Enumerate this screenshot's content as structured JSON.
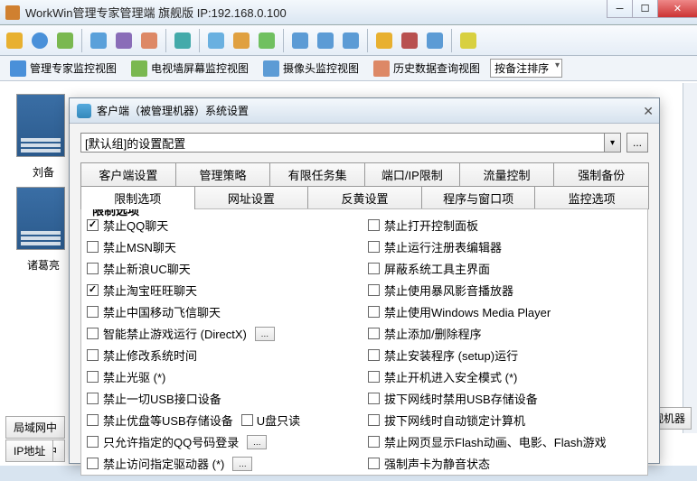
{
  "outer": {
    "title": "WorkWin管理专家管理端  旗舰版 IP:192.168.0.100"
  },
  "viewbar": {
    "v1": "管理专家监控视图",
    "v2": "电视墙屏幕监控视图",
    "v3": "摄像头监控视图",
    "v4": "历史数据查询视图",
    "sort": "按备注排序"
  },
  "thumbs": {
    "t1": "刘备",
    "t2": "诸葛亮"
  },
  "bottom": {
    "b1": "局域网中",
    "b2": "IP地址",
    "r": "监视机器"
  },
  "dialog": {
    "title": "客户端（被管理机器）系统设置",
    "combo": "[默认组]的设置配置",
    "dots": "...",
    "tabs_r1": {
      "t0": "客户端设置",
      "t1": "管理策略",
      "t2": "有限任务集",
      "t3": "端口/IP限制",
      "t4": "流量控制",
      "t5": "强制备份"
    },
    "tabs_r2": {
      "t0": "限制选项",
      "t1": "网址设置",
      "t2": "反黄设置",
      "t3": "程序与窗口项",
      "t4": "监控选项"
    },
    "group_title": "限制选项",
    "left": {
      "c0": {
        "label": "禁止QQ聊天",
        "checked": true
      },
      "c1": {
        "label": "禁止MSN聊天",
        "checked": false
      },
      "c2": {
        "label": "禁止新浪UC聊天",
        "checked": false
      },
      "c3": {
        "label": "禁止淘宝旺旺聊天",
        "checked": true
      },
      "c4": {
        "label": "禁止中国移动飞信聊天",
        "checked": false
      },
      "c5": {
        "label": "智能禁止游戏运行 (DirectX)",
        "checked": false,
        "btn": true
      },
      "c6": {
        "label": "禁止修改系统时间",
        "checked": false
      },
      "c7": {
        "label": "禁止光驱 (*)",
        "checked": false
      },
      "c8": {
        "label": "禁止一切USB接口设备",
        "checked": false
      },
      "c9": {
        "label": "禁止优盘等USB存储设备",
        "checked": false,
        "inline_label": "U盘只读"
      },
      "c10": {
        "label": "只允许指定的QQ号码登录",
        "checked": false,
        "btn": true
      },
      "c11": {
        "label": "禁止访问指定驱动器 (*)",
        "checked": false,
        "btn": true
      }
    },
    "right": {
      "c0": {
        "label": "禁止打开控制面板",
        "checked": false
      },
      "c1": {
        "label": "禁止运行注册表编辑器",
        "checked": false
      },
      "c2": {
        "label": "屏蔽系统工具主界面",
        "checked": false
      },
      "c3": {
        "label": "禁止使用暴风影音播放器",
        "checked": false
      },
      "c4": {
        "label": "禁止使用Windows Media Player",
        "checked": false
      },
      "c5": {
        "label": "禁止添加/删除程序",
        "checked": false
      },
      "c6": {
        "label": "禁止安装程序 (setup)运行",
        "checked": false
      },
      "c7": {
        "label": "禁止开机进入安全模式 (*)",
        "checked": false
      },
      "c8": {
        "label": "拔下网线时禁用USB存储设备",
        "checked": false
      },
      "c9": {
        "label": "拔下网线时自动锁定计算机",
        "checked": false
      },
      "c10": {
        "label": "禁止网页显示Flash动画、电影、Flash游戏",
        "checked": false
      },
      "c11": {
        "label": "强制声卡为静音状态",
        "checked": false
      }
    }
  }
}
